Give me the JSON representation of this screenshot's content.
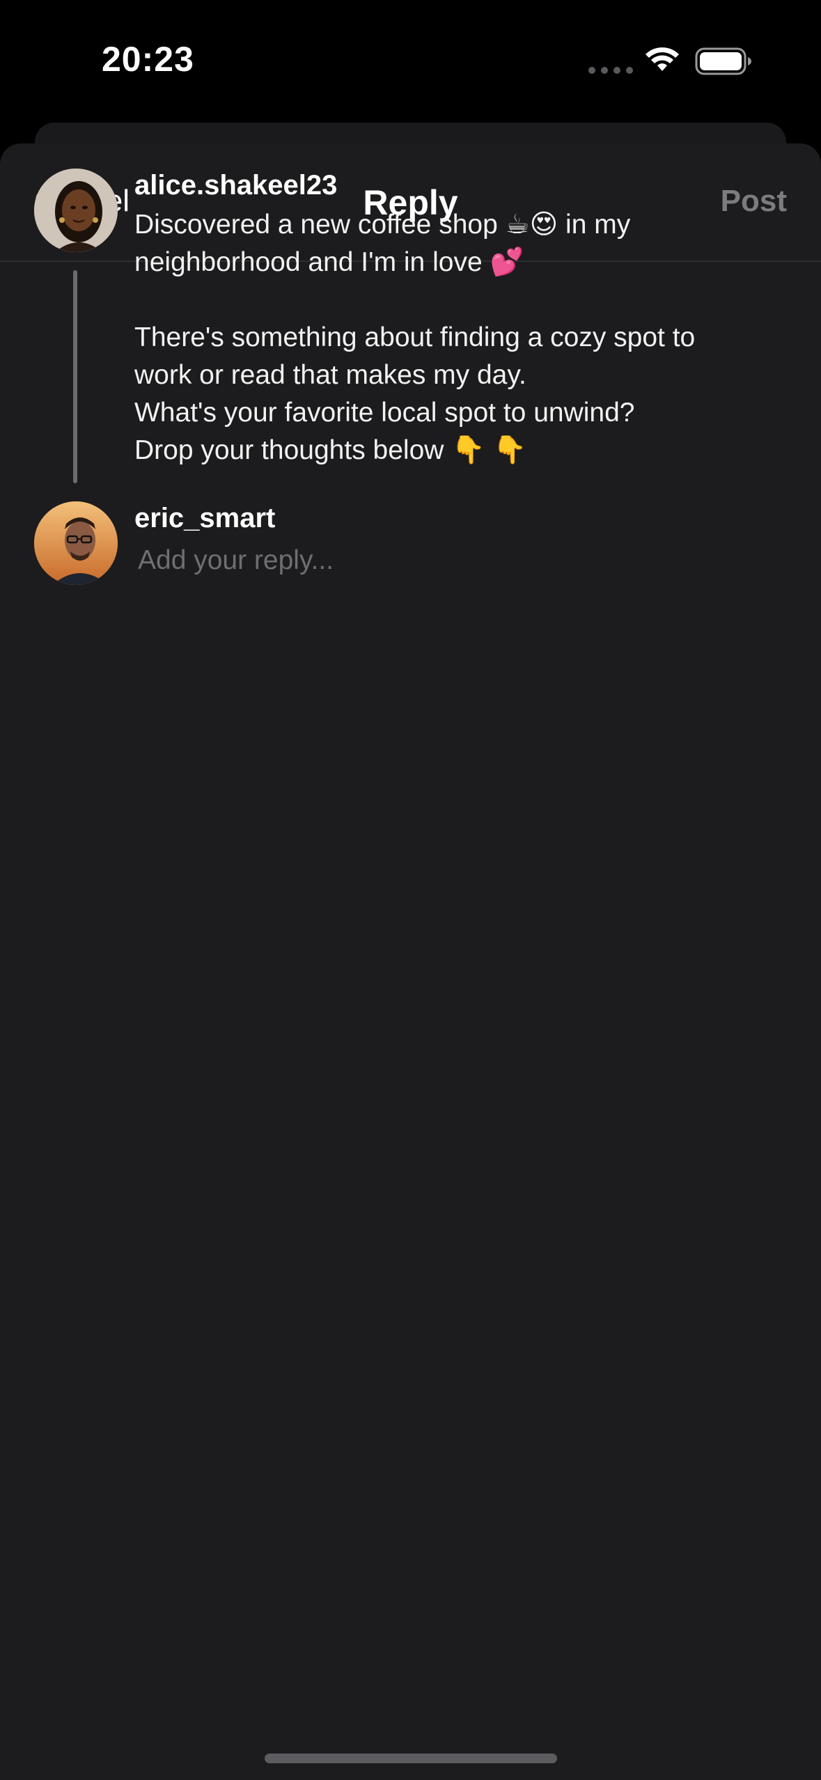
{
  "status_bar": {
    "time": "20:23"
  },
  "nav": {
    "cancel_label": "Cancel",
    "title": "Reply",
    "post_label": "Post"
  },
  "original_post": {
    "username": "alice.shakeel23",
    "lines": [
      "Discovered a new coffee shop ☕😍 in my",
      "neighborhood and I'm in love 💕",
      "",
      "There's something about finding a cozy spot to",
      "work or read that makes my day.",
      "What's your favorite local spot to unwind?",
      "Drop your thoughts below 👇 👇"
    ]
  },
  "reply": {
    "username": "eric_smart",
    "placeholder": "Add your reply...",
    "value": ""
  },
  "colors": {
    "background": "#000000",
    "sheet": "#1c1c1e",
    "post_disabled": "#7c7c80",
    "placeholder": "#6e6e73"
  },
  "icons": {
    "wifi": "wifi-icon",
    "battery": "battery-icon",
    "signal": "signal-dots-icon"
  }
}
